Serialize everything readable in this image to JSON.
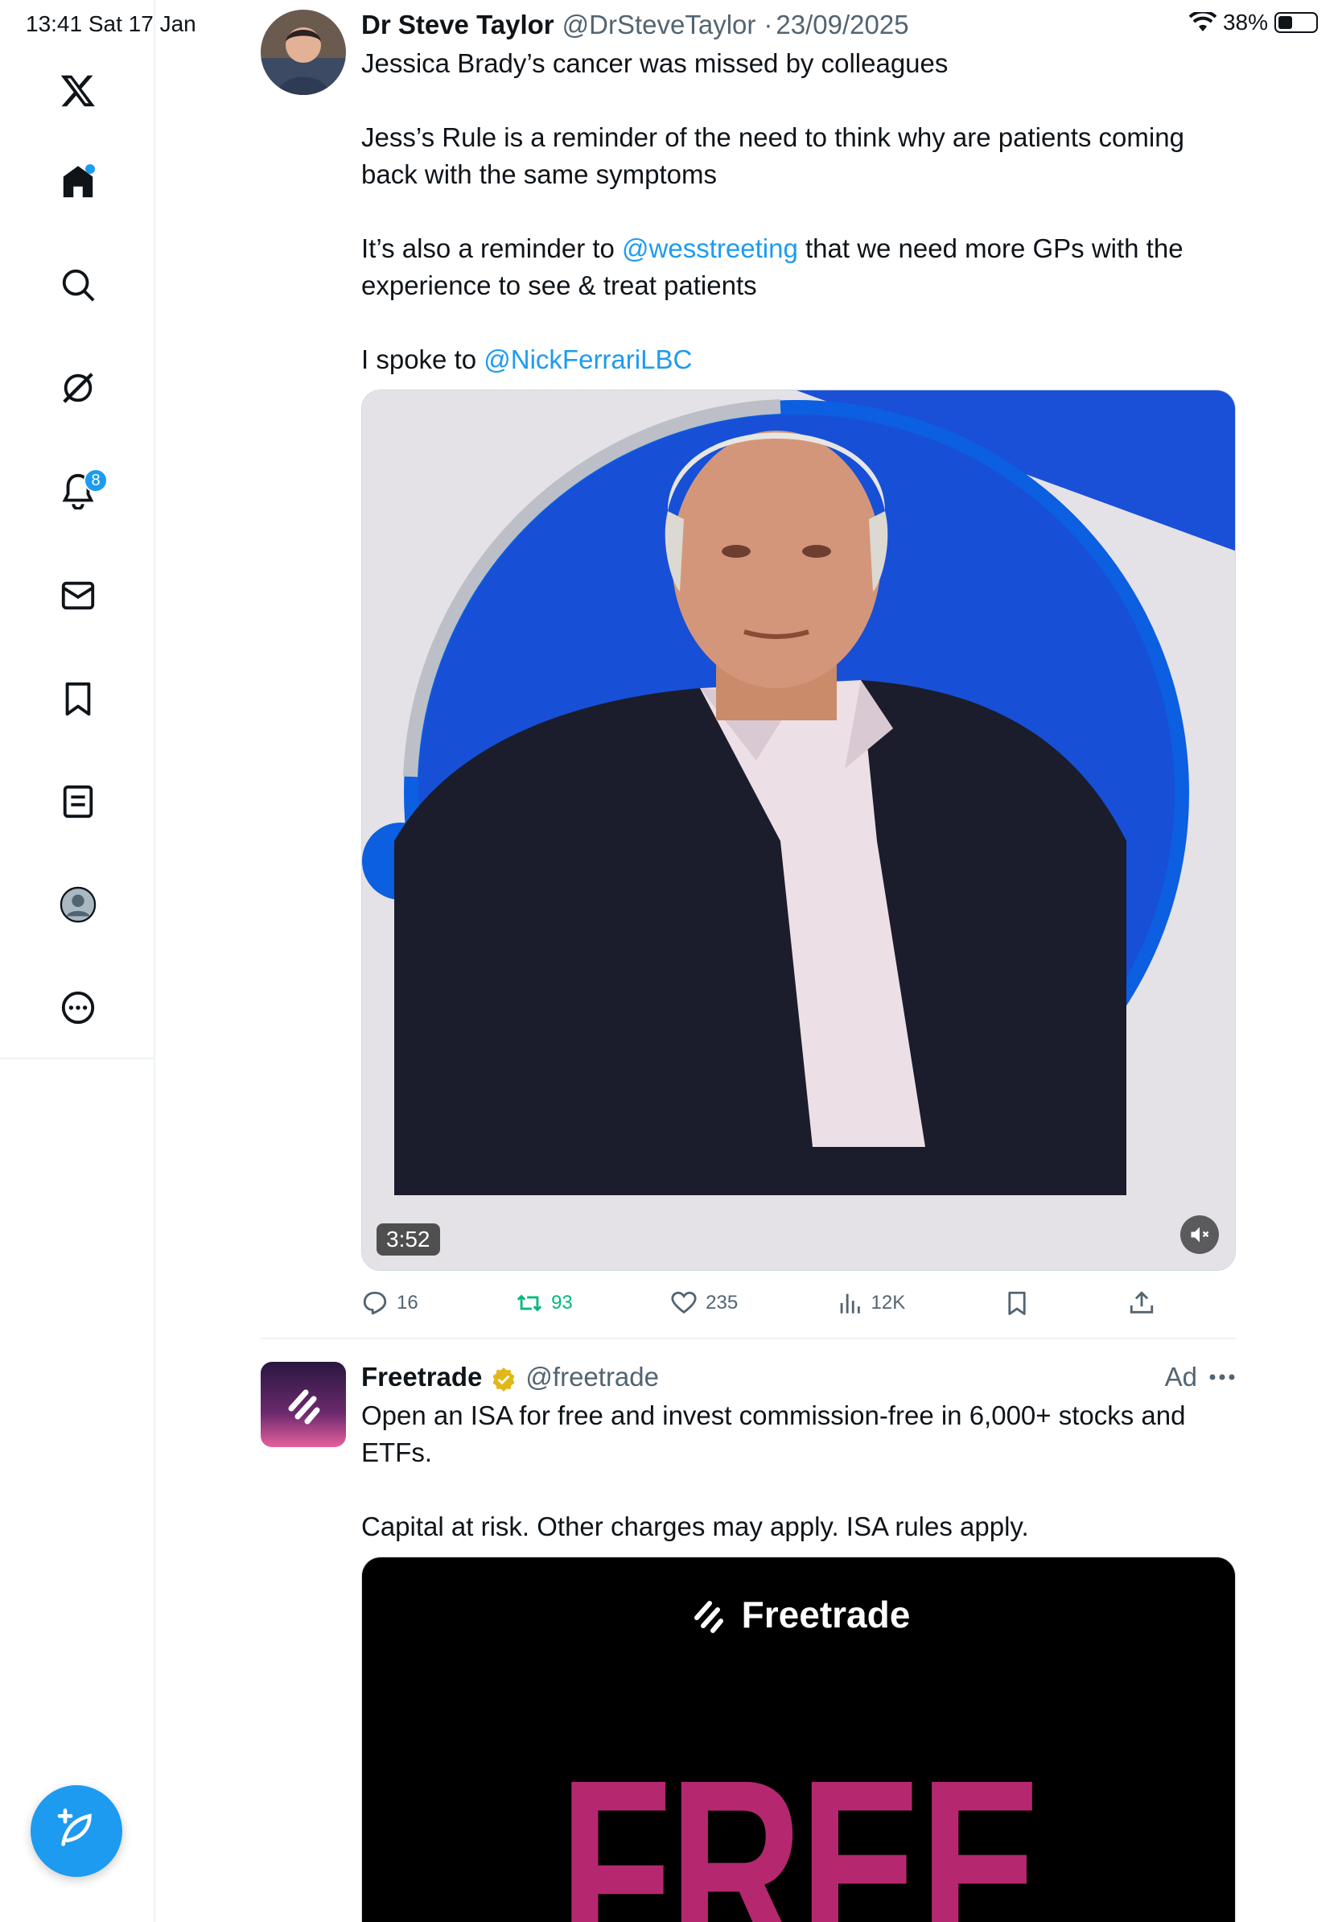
{
  "status_bar": {
    "time": "13:41  Sat 17 Jan",
    "battery": "38%",
    "battery_level": 0.38
  },
  "sidebar": {
    "items": [
      {
        "name": "x-logo-icon"
      },
      {
        "name": "home-icon"
      },
      {
        "name": "search-icon"
      },
      {
        "name": "grok-icon"
      },
      {
        "name": "notifications-icon",
        "badge": "8"
      },
      {
        "name": "messages-icon"
      },
      {
        "name": "bookmarks-icon"
      },
      {
        "name": "lists-icon"
      },
      {
        "name": "profile-icon"
      },
      {
        "name": "more-icon"
      }
    ],
    "compose_icon": "compose-icon"
  },
  "tweet1": {
    "name": "Dr Steve Taylor",
    "handle": "@DrSteveTaylor",
    "separator": "·",
    "date": "23/09/2025",
    "p1": "Jessica Brady’s cancer was missed by colleagues",
    "p2": "Jess’s Rule is a reminder of the need to think why are patients coming back with the same symptoms",
    "p3_before": "It’s also a reminder to ",
    "p3_mention": "@wesstreeting",
    "p3_after": " that we need more GPs with the experience to see & treat patients",
    "p4_before": "I spoke to ",
    "p4_mention": "@NickFerrariLBC",
    "video_duration": "3:52",
    "replies": "16",
    "retweets": "93",
    "likes": "235",
    "views": "12K"
  },
  "tweet2": {
    "name": "Freetrade",
    "handle": "@freetrade",
    "ad_label": "Ad",
    "p1": "Open an ISA for free and invest commission-free in 6,000+ stocks and ETFs.",
    "p2": "Capital at risk. Other charges may apply. ISA rules apply.",
    "media_brand": "Freetrade",
    "media_headline": "FREE"
  },
  "colors": {
    "accent": "#1d9bf0",
    "retweet": "#00ba7c",
    "muted": "#536471",
    "brand_pink": "#c2185b"
  }
}
